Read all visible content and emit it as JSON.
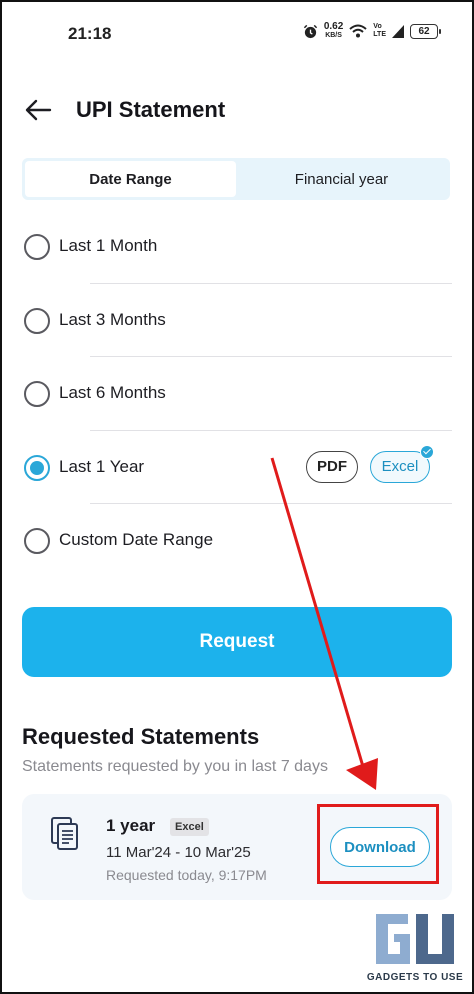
{
  "status_bar": {
    "time": "21:18",
    "net_speed": "0.62",
    "net_unit": "KB/S",
    "volte_top": "Vo",
    "volte_bottom": "LTE",
    "battery": "62",
    "icons": [
      "alarm-icon",
      "wifi-icon",
      "signal-icon",
      "battery-icon"
    ]
  },
  "header": {
    "title": "UPI Statement",
    "back_icon": "arrow-left-icon"
  },
  "tabs": [
    {
      "label": "Date Range",
      "active": true
    },
    {
      "label": "Financial year",
      "active": false
    }
  ],
  "options": [
    {
      "label": "Last 1 Month",
      "selected": false
    },
    {
      "label": "Last 3 Months",
      "selected": false
    },
    {
      "label": "Last 6 Months",
      "selected": false
    },
    {
      "label": "Last 1 Year",
      "selected": true
    },
    {
      "label": "Custom Date Range",
      "selected": false
    }
  ],
  "formats": {
    "pdf": "PDF",
    "excel": "Excel",
    "selected": "Excel"
  },
  "request_button": "Request",
  "requested": {
    "title": "Requested Statements",
    "subtitle": "Statements requested by you in last 7 days",
    "items": [
      {
        "period": "1 year",
        "format": "Excel",
        "range": "11 Mar'24 - 10 Mar'25",
        "requested_at": "Requested today, 9:17PM",
        "action": "Download",
        "icon": "document-stack-icon"
      }
    ]
  },
  "watermark": {
    "text": "GADGETS TO USE"
  },
  "colors": {
    "accent": "#1cb2ec",
    "accent_text": "#1c8fc0",
    "annotation": "#e01b1b",
    "segment_bg": "#e7f4fb"
  }
}
